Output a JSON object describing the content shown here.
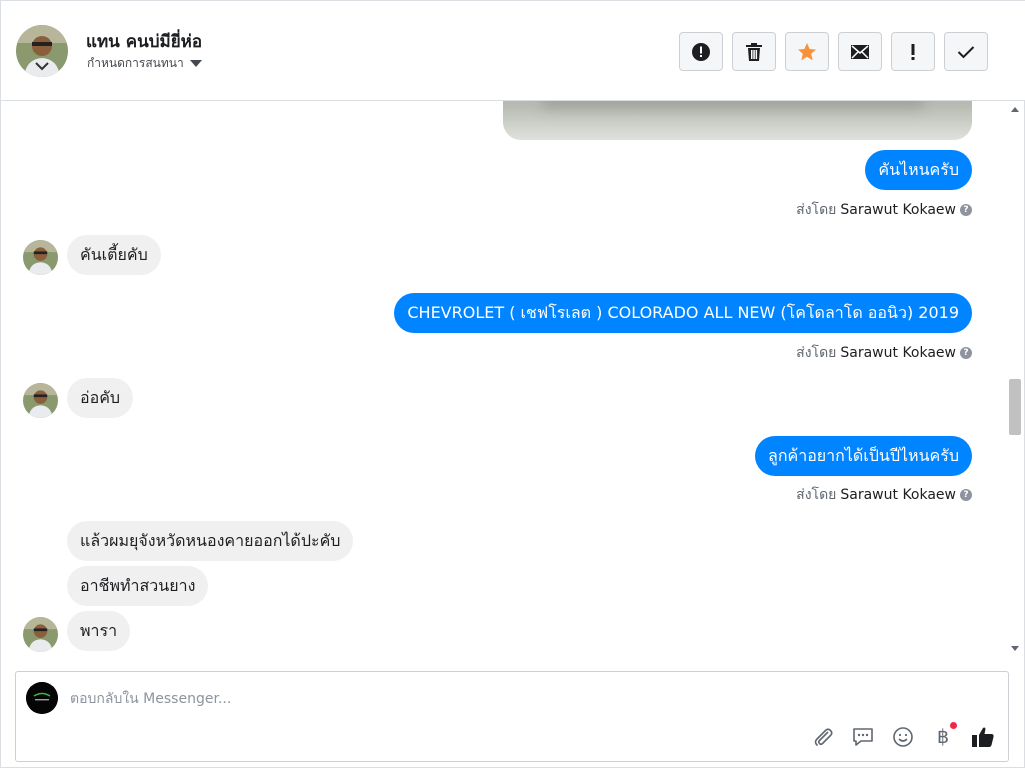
{
  "header": {
    "contact_name": "แทน คนบ่มียี่ห่อ",
    "subtitle": "กำหนดการสนทนา",
    "toolbar": [
      {
        "name": "report-spam-button",
        "icon": "alert-circle-icon"
      },
      {
        "name": "delete-button",
        "icon": "trash-icon"
      },
      {
        "name": "star-button",
        "icon": "star-icon"
      },
      {
        "name": "mark-unread-button",
        "icon": "envelope-icon"
      },
      {
        "name": "mark-important-button",
        "icon": "exclamation-icon"
      },
      {
        "name": "mark-done-button",
        "icon": "checkmark-icon"
      }
    ]
  },
  "messages": [
    {
      "side": "out",
      "text": "คันไหนครับ"
    },
    {
      "side": "out-meta",
      "prefix": "ส่งโดย",
      "sender": "Sarawut Kokaew"
    },
    {
      "side": "in",
      "text": "คันเตี้ยคับ"
    },
    {
      "side": "out",
      "text": "CHEVROLET ( เชฟโรเลต ) COLORADO ALL NEW (โคโดลาโด ออนิว) 2019"
    },
    {
      "side": "out-meta",
      "prefix": "ส่งโดย",
      "sender": "Sarawut Kokaew"
    },
    {
      "side": "in",
      "text": "อ่อคับ"
    },
    {
      "side": "out",
      "text": "ลูกค้าอยากได้เป็นปีไหนครับ"
    },
    {
      "side": "out-meta",
      "prefix": "ส่งโดย",
      "sender": "Sarawut Kokaew"
    },
    {
      "side": "in",
      "text": "แล้วผมยุจังหวัดหนองคายออกได้ปะคับ"
    },
    {
      "side": "in",
      "text": "อาชีพทำสวนยาง"
    },
    {
      "side": "in",
      "text": "พารา"
    }
  ],
  "composer": {
    "placeholder": "ตอบกลับใน Messenger...",
    "actions": [
      "paperclip-icon",
      "saved-reply-icon",
      "emoji-icon",
      "baht-payment-icon",
      "thumbs-up-icon"
    ],
    "baht_symbol": "฿"
  },
  "colors": {
    "outgoing_bubble": "#0084ff",
    "incoming_bubble": "#f1f0f0",
    "star": "#f7923a"
  }
}
